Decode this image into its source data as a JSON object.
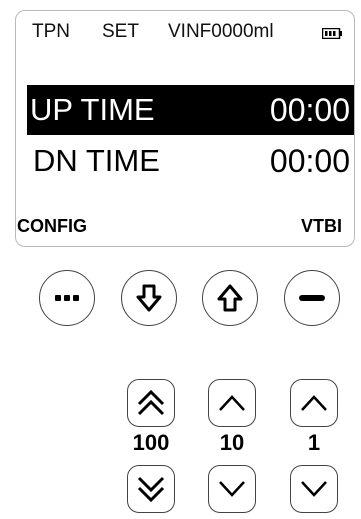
{
  "screen": {
    "status": {
      "mode": "TPN",
      "set": "SET",
      "vinf": "VINF0000ml",
      "battery_icon": "battery-icon"
    },
    "rows": [
      {
        "label": "UP TIME",
        "value": "00:00",
        "selected": true
      },
      {
        "label": "DN TIME",
        "value": "00:00",
        "selected": false
      }
    ],
    "softkeys": {
      "left": "CONFIG",
      "right": "VTBI"
    }
  },
  "keypad": {
    "round_buttons": [
      "more-icon",
      "arrow-down-icon",
      "arrow-up-icon",
      "minus-icon"
    ],
    "steppers": [
      {
        "label": "100",
        "up_icon": "double-chevron-up-icon",
        "down_icon": "double-chevron-down-icon"
      },
      {
        "label": "10",
        "up_icon": "chevron-up-icon",
        "down_icon": "chevron-down-icon"
      },
      {
        "label": "1",
        "up_icon": "chevron-up-icon",
        "down_icon": "chevron-down-icon"
      }
    ]
  },
  "colors": {
    "selected_bg": "#000000",
    "selected_fg": "#ffffff",
    "border": "#444444"
  }
}
